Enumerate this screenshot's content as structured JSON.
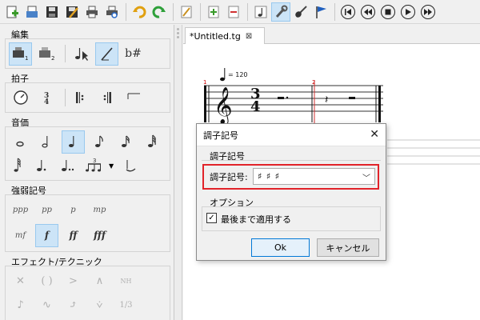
{
  "editor": {
    "tab_label": "*Untitled.tg",
    "tempo": "= 120",
    "measure1_number": "1",
    "measure2_number": "2",
    "time_sig_top": "3",
    "time_sig_bottom": "4"
  },
  "left_panel": {
    "sections": {
      "edit_title": "編集",
      "beat_title": "拍子",
      "duration_title": "音価",
      "dynamics_title": "強弱記号",
      "effects_title": "エフェクト/テクニック"
    },
    "edit_icons": {
      "voice1_subscript": "1",
      "voice2_subscript": "2",
      "accidental": "b#"
    },
    "dynamics": [
      "ppp",
      "pp",
      "p",
      "mp",
      "mf",
      "f",
      "ff",
      "fff"
    ],
    "tuplet_label": "3",
    "effect_glyphs": [
      "( )",
      "NH",
      "1/3"
    ]
  },
  "dialog": {
    "title": "調子記号",
    "keysig_group_label": "調子記号",
    "keysig_field_label": "調子記号:",
    "keysig_value": "♯ ♯ ♯",
    "options_group_label": "オプション",
    "apply_to_end_label": "最後まで適用する",
    "apply_to_end_checked": true,
    "ok_label": "Ok",
    "cancel_label": "キャンセル"
  }
}
